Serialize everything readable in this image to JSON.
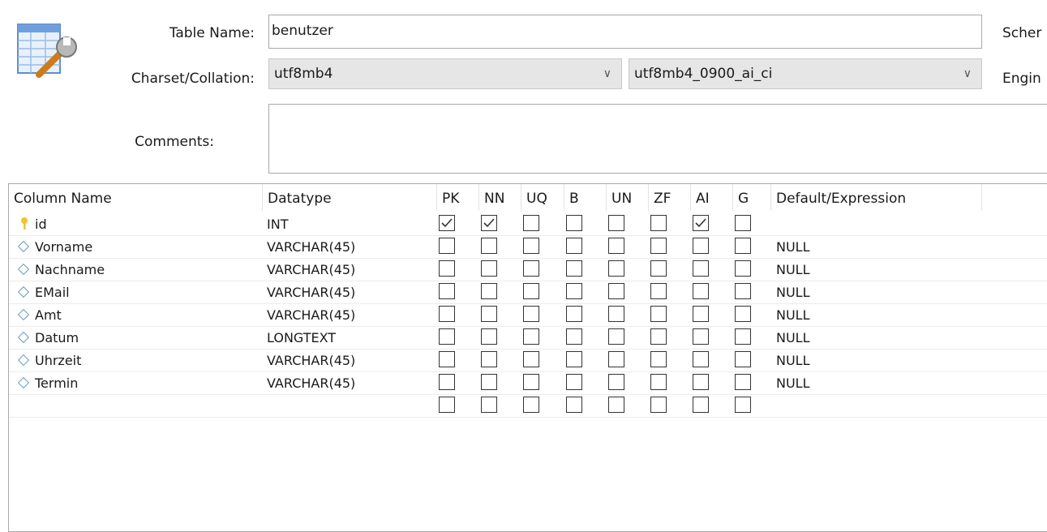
{
  "form": {
    "table_name_label": "Table Name:",
    "table_name_value": "benutzer",
    "charset_label": "Charset/Collation:",
    "charset_value": "utf8mb4",
    "collation_value": "utf8mb4_0900_ai_ci",
    "comments_label": "Comments:",
    "comments_value": "",
    "schema_label_cut": "Scher",
    "engine_label_cut": "Engin"
  },
  "icons": {
    "table_icon": "table-wrench-icon",
    "pk": "key-icon",
    "column": "diamond-icon",
    "dropdown": "chevron-down-icon"
  },
  "grid": {
    "headers": [
      "Column Name",
      "Datatype",
      "PK",
      "NN",
      "UQ",
      "B",
      "UN",
      "ZF",
      "AI",
      "G",
      "Default/Expression"
    ],
    "rows": [
      {
        "name": "id",
        "type": "INT",
        "pk": true,
        "nn": true,
        "uq": false,
        "b": false,
        "un": false,
        "zf": false,
        "ai": true,
        "g": false,
        "default": "",
        "is_pk": true
      },
      {
        "name": "Vorname",
        "type": "VARCHAR(45)",
        "pk": false,
        "nn": false,
        "uq": false,
        "b": false,
        "un": false,
        "zf": false,
        "ai": false,
        "g": false,
        "default": "NULL"
      },
      {
        "name": "Nachname",
        "type": "VARCHAR(45)",
        "pk": false,
        "nn": false,
        "uq": false,
        "b": false,
        "un": false,
        "zf": false,
        "ai": false,
        "g": false,
        "default": "NULL"
      },
      {
        "name": "EMail",
        "type": "VARCHAR(45)",
        "pk": false,
        "nn": false,
        "uq": false,
        "b": false,
        "un": false,
        "zf": false,
        "ai": false,
        "g": false,
        "default": "NULL"
      },
      {
        "name": "Amt",
        "type": "VARCHAR(45)",
        "pk": false,
        "nn": false,
        "uq": false,
        "b": false,
        "un": false,
        "zf": false,
        "ai": false,
        "g": false,
        "default": "NULL"
      },
      {
        "name": "Datum",
        "type": "LONGTEXT",
        "pk": false,
        "nn": false,
        "uq": false,
        "b": false,
        "un": false,
        "zf": false,
        "ai": false,
        "g": false,
        "default": "NULL"
      },
      {
        "name": "Uhrzeit",
        "type": "VARCHAR(45)",
        "pk": false,
        "nn": false,
        "uq": false,
        "b": false,
        "un": false,
        "zf": false,
        "ai": false,
        "g": false,
        "default": "NULL"
      },
      {
        "name": "Termin",
        "type": "VARCHAR(45)",
        "pk": false,
        "nn": false,
        "uq": false,
        "b": false,
        "un": false,
        "zf": false,
        "ai": false,
        "g": false,
        "default": "NULL"
      }
    ]
  }
}
